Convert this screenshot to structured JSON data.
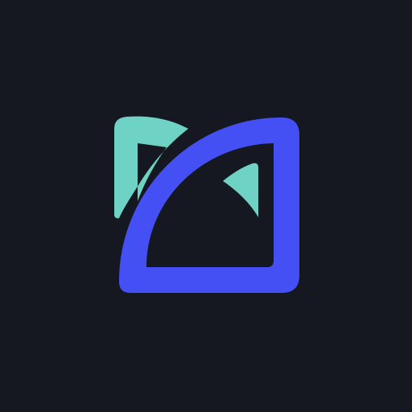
{
  "page": {
    "background": "#161821"
  },
  "logo": {
    "icon": "app-logo-icon",
    "colors": {
      "primary": "#4450F3",
      "accent": "#6ED3C4"
    }
  }
}
